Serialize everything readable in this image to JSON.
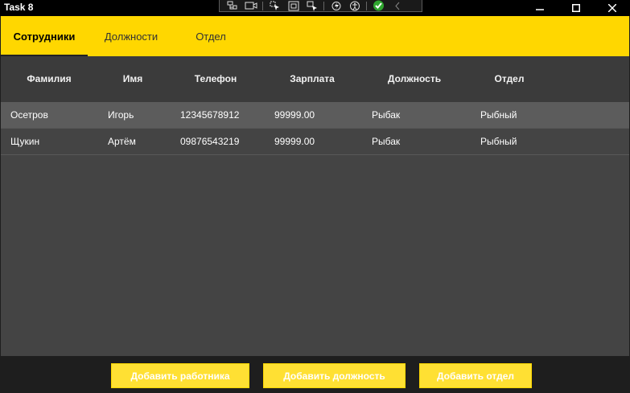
{
  "window": {
    "title": "Task 8"
  },
  "tabs": [
    {
      "label": "Сотрудники",
      "active": true
    },
    {
      "label": "Должности",
      "active": false
    },
    {
      "label": "Отдел",
      "active": false
    }
  ],
  "table": {
    "columns": [
      "Фамилия",
      "Имя",
      "Телефон",
      "Зарплата",
      "Должность",
      "Отдел"
    ],
    "rows": [
      {
        "surname": "Осетров",
        "name": "Игорь",
        "phone": "12345678912",
        "salary": "99999.00",
        "position": "Рыбак",
        "department": "Рыбный",
        "selected": true
      },
      {
        "surname": "Щукин",
        "name": "Артём",
        "phone": "09876543219",
        "salary": "99999.00",
        "position": "Рыбак",
        "department": "Рыбный",
        "selected": false
      }
    ]
  },
  "footer": {
    "add_employee": "Добавить работника",
    "add_position": "Добавить должность",
    "add_department": "Добавить отдел"
  },
  "colors": {
    "accent": "#ffd700",
    "button": "#ffe033",
    "header_bg": "#3b3b3b",
    "content_bg": "#444444",
    "selected_row": "#5c5c5c"
  },
  "icons": [
    "live-visual-tree-icon",
    "record-icon",
    "select-element-icon",
    "display-layout-adorners-icon",
    "track-focus-icon",
    "hot-reload-icon",
    "accessibility-icon",
    "binding-ok-icon",
    "collapse-toolbar-icon",
    "minimize-icon",
    "maximize-icon",
    "close-icon"
  ]
}
